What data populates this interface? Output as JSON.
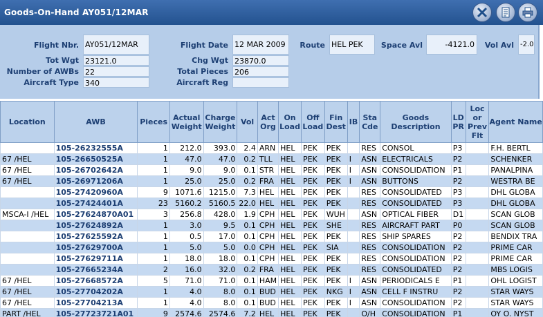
{
  "window": {
    "title": "Goods-On-Hand AY051/12MAR"
  },
  "toolbar": {
    "icons": [
      "excel-export-icon",
      "list-report-icon",
      "print-icon"
    ]
  },
  "header": {
    "flight_nbr": {
      "label": "Flight Nbr.",
      "value": "AY051/12MAR"
    },
    "flight_date": {
      "label": "Flight Date",
      "value": "12 MAR 2009"
    },
    "route": {
      "label": "Route",
      "value": "HEL PEK"
    },
    "space_avl": {
      "label": "Space Avl",
      "value": "-4121.0"
    },
    "vol_avl": {
      "label": "Vol Avl",
      "value": "-2.0"
    },
    "tot_wgt": {
      "label": "Tot Wgt",
      "value": "23121.0"
    },
    "chg_wgt": {
      "label": "Chg Wgt",
      "value": "23870.0"
    },
    "num_awbs": {
      "label": "Number of AWBs",
      "value": "22"
    },
    "total_pieces": {
      "label": "Total Pieces",
      "value": "206"
    },
    "aircraft_type": {
      "label": "Aircraft Type",
      "value": "340"
    },
    "aircraft_reg": {
      "label": "Aircraft Reg",
      "value": ""
    }
  },
  "grid": {
    "columns": [
      "Location",
      "AWB",
      "Pieces",
      "Actual Weight",
      "Charge Weight",
      "Vol",
      "Act Org",
      "On Load",
      "Off Load",
      "Fin Dest",
      "IB",
      "Sta Cde",
      "Goods Description",
      "LD PR",
      "Loc or Prev Flt",
      "Agent Name"
    ],
    "rows": [
      [
        "",
        "105-26232555A",
        "1",
        "212.0",
        "393.0",
        "2.4",
        "ARN",
        "HEL",
        "PEK",
        "PEK",
        "",
        "RES",
        "CONSOL",
        "P3",
        "",
        "F.H. BERTL"
      ],
      [
        "67 /HEL",
        "105-26650525A",
        "1",
        "47.0",
        "47.0",
        "0.2",
        "TLL",
        "HEL",
        "PEK",
        "PEK",
        "I",
        "ASN",
        "ELECTRICALS",
        "P2",
        "",
        "SCHENKER"
      ],
      [
        "67 /HEL",
        "105-26702642A",
        "1",
        "9.0",
        "9.0",
        "0.1",
        "STR",
        "HEL",
        "PEK",
        "PEK",
        "I",
        "ASN",
        "CONSOLIDATION",
        "P1",
        "",
        "PANALPINA"
      ],
      [
        "67 /HEL",
        "105-26971206A",
        "1",
        "25.0",
        "25.0",
        "0.2",
        "FRA",
        "HEL",
        "PEK",
        "PEK",
        "I",
        "ASN",
        "BUTTONS",
        "P2",
        "",
        "WESTRA BE"
      ],
      [
        "",
        "105-27420960A",
        "9",
        "1071.6",
        "1215.0",
        "7.3",
        "HEL",
        "HEL",
        "PEK",
        "PEK",
        "",
        "RES",
        "CONSOLIDATED",
        "P3",
        "",
        "DHL GLOBA"
      ],
      [
        "",
        "105-27424401A",
        "23",
        "5160.2",
        "5160.5",
        "22.0",
        "HEL",
        "HEL",
        "PEK",
        "PEK",
        "",
        "RES",
        "CONSOLIDATED",
        "P3",
        "",
        "DHL GLOBA"
      ],
      [
        "MSCA-I /HEL",
        "105-27624870A01",
        "3",
        "256.8",
        "428.0",
        "1.9",
        "CPH",
        "HEL",
        "PEK",
        "WUH",
        "",
        "ASN",
        "OPTICAL FIBER",
        "D1",
        "",
        "SCAN GLOB"
      ],
      [
        "",
        "105-27624892A",
        "1",
        "3.0",
        "9.5",
        "0.1",
        "CPH",
        "HEL",
        "PEK",
        "SHE",
        "",
        "RES",
        "AIRCRAFT PART",
        "P0",
        "",
        "SCAN GLOB"
      ],
      [
        "",
        "105-27625592A",
        "1",
        "0.5",
        "17.0",
        "0.1",
        "CPH",
        "HEL",
        "PEK",
        "PEK",
        "",
        "RES",
        "SHIP SPARES",
        "P2",
        "",
        "BENDIX TRA"
      ],
      [
        "",
        "105-27629700A",
        "1",
        "5.0",
        "5.0",
        "0.0",
        "CPH",
        "HEL",
        "PEK",
        "SIA",
        "",
        "RES",
        "CONSOLIDATION",
        "P2",
        "",
        "PRIME CAR"
      ],
      [
        "",
        "105-27629711A",
        "1",
        "18.0",
        "18.0",
        "0.1",
        "CPH",
        "HEL",
        "PEK",
        "PEK",
        "",
        "RES",
        "CONSOLIDATION",
        "P2",
        "",
        "PRIME CAR"
      ],
      [
        "",
        "105-27665234A",
        "2",
        "16.0",
        "32.0",
        "0.2",
        "FRA",
        "HEL",
        "PEK",
        "PEK",
        "",
        "RES",
        "CONSOLIDATED",
        "P2",
        "",
        "MBS LOGIS"
      ],
      [
        "67 /HEL",
        "105-27668572A",
        "5",
        "71.0",
        "71.0",
        "0.1",
        "HAM",
        "HEL",
        "PEK",
        "PEK",
        "I",
        "ASN",
        "PERIODICALS E",
        "P1",
        "",
        "OHL LOGIST"
      ],
      [
        "67 /HEL",
        "105-27704202A",
        "1",
        "4.0",
        "8.0",
        "0.1",
        "BUD",
        "HEL",
        "PEK",
        "NKG",
        "I",
        "ASN",
        "CELL F INSTRU",
        "P2",
        "",
        "STAR WAYS"
      ],
      [
        "67 /HEL",
        "105-27704213A",
        "1",
        "4.0",
        "8.0",
        "0.1",
        "BUD",
        "HEL",
        "PEK",
        "PEK",
        "I",
        "ASN",
        "CONSOLIDATION",
        "P2",
        "",
        "STAR WAYS"
      ],
      [
        "PART /HEL",
        "105-27723721A01",
        "9",
        "2574.6",
        "2574.6",
        "7.2",
        "HEL",
        "HEL",
        "PEK",
        "PEK",
        "",
        "O/H",
        "CONSOLIDATION",
        "P1",
        "",
        "OY O. NYST"
      ]
    ]
  },
  "colors": {
    "title_bar": "#2f5f9f",
    "header_panel": "#b6cde9",
    "row_alt": "#c5d9f1",
    "label_text": "#1d3f73"
  }
}
